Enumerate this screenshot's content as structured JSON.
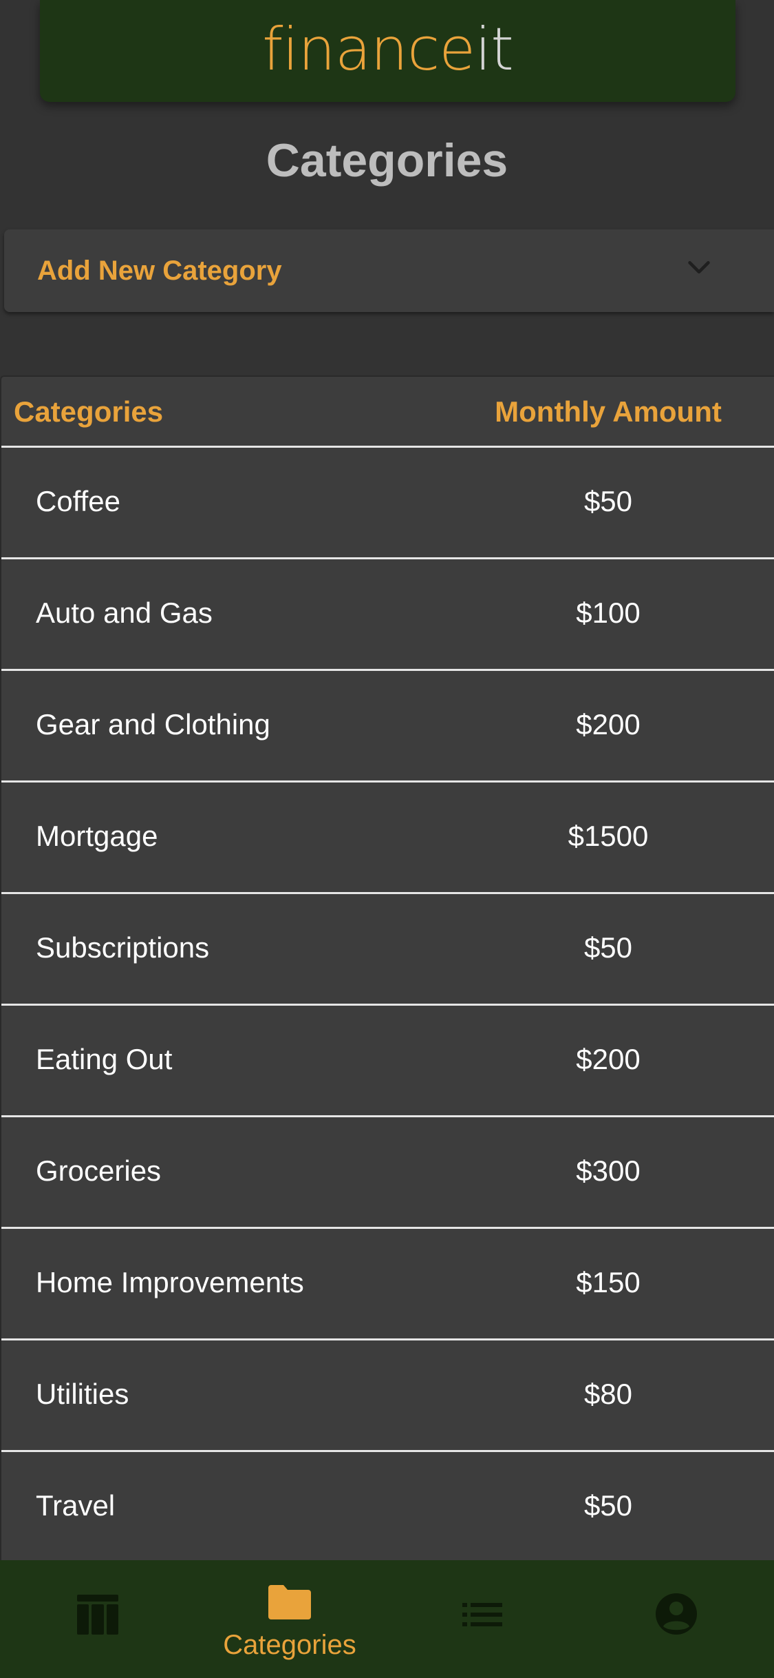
{
  "brand": {
    "part1": "finance",
    "part2": "it"
  },
  "page": {
    "title": "Categories"
  },
  "add_panel": {
    "label": "Add New Category",
    "expand_icon": "chevron-down-icon"
  },
  "table": {
    "headers": {
      "category": "Categories",
      "amount": "Monthly Amount"
    },
    "rows": [
      {
        "name": "Coffee",
        "amount": "$50"
      },
      {
        "name": "Auto and Gas",
        "amount": "$100"
      },
      {
        "name": "Gear and Clothing",
        "amount": "$200"
      },
      {
        "name": "Mortgage",
        "amount": "$1500"
      },
      {
        "name": "Subscriptions",
        "amount": "$50"
      },
      {
        "name": "Eating Out",
        "amount": "$200"
      },
      {
        "name": "Groceries",
        "amount": "$300"
      },
      {
        "name": "Home Improvements",
        "amount": "$150"
      },
      {
        "name": "Utilities",
        "amount": "$80"
      },
      {
        "name": "Travel",
        "amount": "$50"
      }
    ]
  },
  "bottom_nav": {
    "items": [
      {
        "icon": "table-icon",
        "label": "",
        "active": false
      },
      {
        "icon": "folder-icon",
        "label": "Categories",
        "active": true
      },
      {
        "icon": "list-icon",
        "label": "",
        "active": false
      },
      {
        "icon": "account-icon",
        "label": "",
        "active": false
      }
    ]
  },
  "colors": {
    "accent": "#e9a33b",
    "brand_green": "#1e3615",
    "background": "#333333",
    "surface": "#3d3d3d"
  }
}
